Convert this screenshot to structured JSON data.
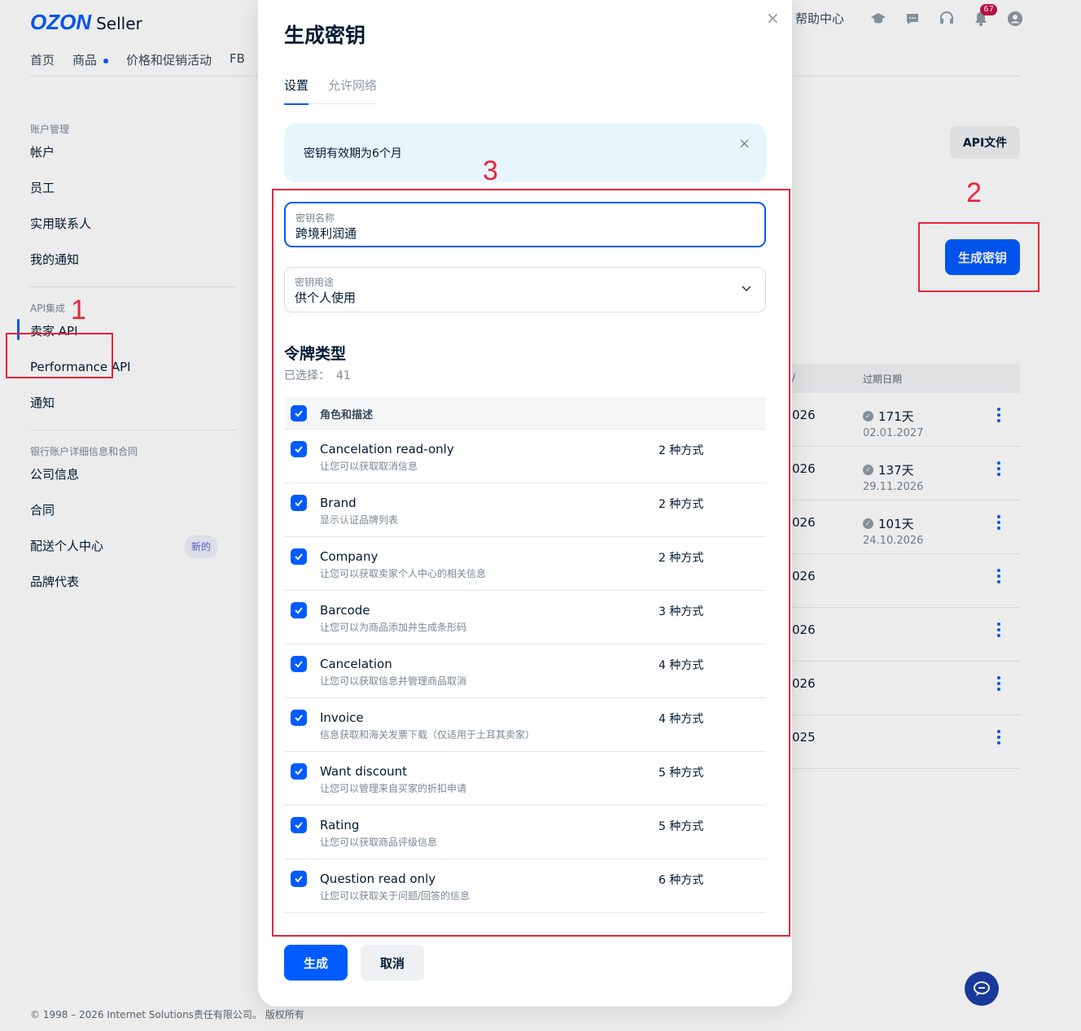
{
  "header": {
    "logo_brand": "OZON",
    "logo_product": "Seller",
    "nav": [
      "首页",
      "商品",
      "价格和促销活动",
      "FB"
    ],
    "help": "帮助中心",
    "notif_count": "67"
  },
  "sidebar": {
    "sections": [
      {
        "title": "账户管理",
        "items": [
          "帐户",
          "员工",
          "实用联系人",
          "我的通知"
        ]
      },
      {
        "title": "API集成",
        "items": [
          "卖家 API",
          "Performance API",
          "通知"
        ]
      },
      {
        "title": "银行账户详细信息和合同",
        "items": [
          "公司信息",
          "合同",
          "配送个人中心",
          "品牌代表"
        ]
      }
    ],
    "new_tag": "新的"
  },
  "background": {
    "api_doc_button": "API文件",
    "generate_button": "生成密钥",
    "table_header_expire": "过期日期",
    "table_header_cut": "/",
    "rows": [
      {
        "year": "026",
        "days": "171天",
        "date": "02.01.2027"
      },
      {
        "year": "026",
        "days": "137天",
        "date": "29.11.2026"
      },
      {
        "year": "026",
        "days": "101天",
        "date": "24.10.2026"
      },
      {
        "year": "026",
        "days": "",
        "date": ""
      },
      {
        "year": "026",
        "days": "",
        "date": ""
      },
      {
        "year": "026",
        "days": "",
        "date": ""
      },
      {
        "year": "025",
        "days": "",
        "date": ""
      }
    ]
  },
  "footer": "© 1998 – 2026 Internet Solutions责任有限公司。 版权所有",
  "annotations": [
    "1",
    "2",
    "3"
  ],
  "modal": {
    "close": "×",
    "title": "生成密钥",
    "tabs": [
      "设置",
      "允许网络"
    ],
    "info": "密钥有效期为6个月",
    "key_name_label": "密钥名称",
    "key_name_value": "跨境利润通",
    "purpose_label": "密钥用途",
    "purpose_value": "供个人使用",
    "token_type_title": "令牌类型",
    "selected_label": "已选择：",
    "selected_count": "41",
    "table_header": "角色和描述",
    "rows": [
      {
        "name": "Cancelation read-only",
        "desc": "让您可以获取取消信息",
        "count": "2 种方式"
      },
      {
        "name": "Brand",
        "desc": "显示认证品牌列表",
        "count": "2 种方式"
      },
      {
        "name": "Company",
        "desc": "让您可以获取卖家个人中心的相关信息",
        "count": "2 种方式"
      },
      {
        "name": "Barcode",
        "desc": "让您可以为商品添加并生成条形码",
        "count": "3 种方式"
      },
      {
        "name": "Cancelation",
        "desc": "让您可以获取信息并管理商品取消",
        "count": "4 种方式"
      },
      {
        "name": "Invoice",
        "desc": "信息获取和海关发票下载（仅适用于土耳其卖家）",
        "count": "4 种方式"
      },
      {
        "name": "Want discount",
        "desc": "让您可以管理来自买家的折扣申请",
        "count": "5 种方式"
      },
      {
        "name": "Rating",
        "desc": "让您可以获取商品评级信息",
        "count": "5 种方式"
      },
      {
        "name": "Question read only",
        "desc": "让您可以获取关于问题/回答的信息",
        "count": "6 种方式"
      }
    ],
    "generate": "生成",
    "cancel": "取消"
  }
}
